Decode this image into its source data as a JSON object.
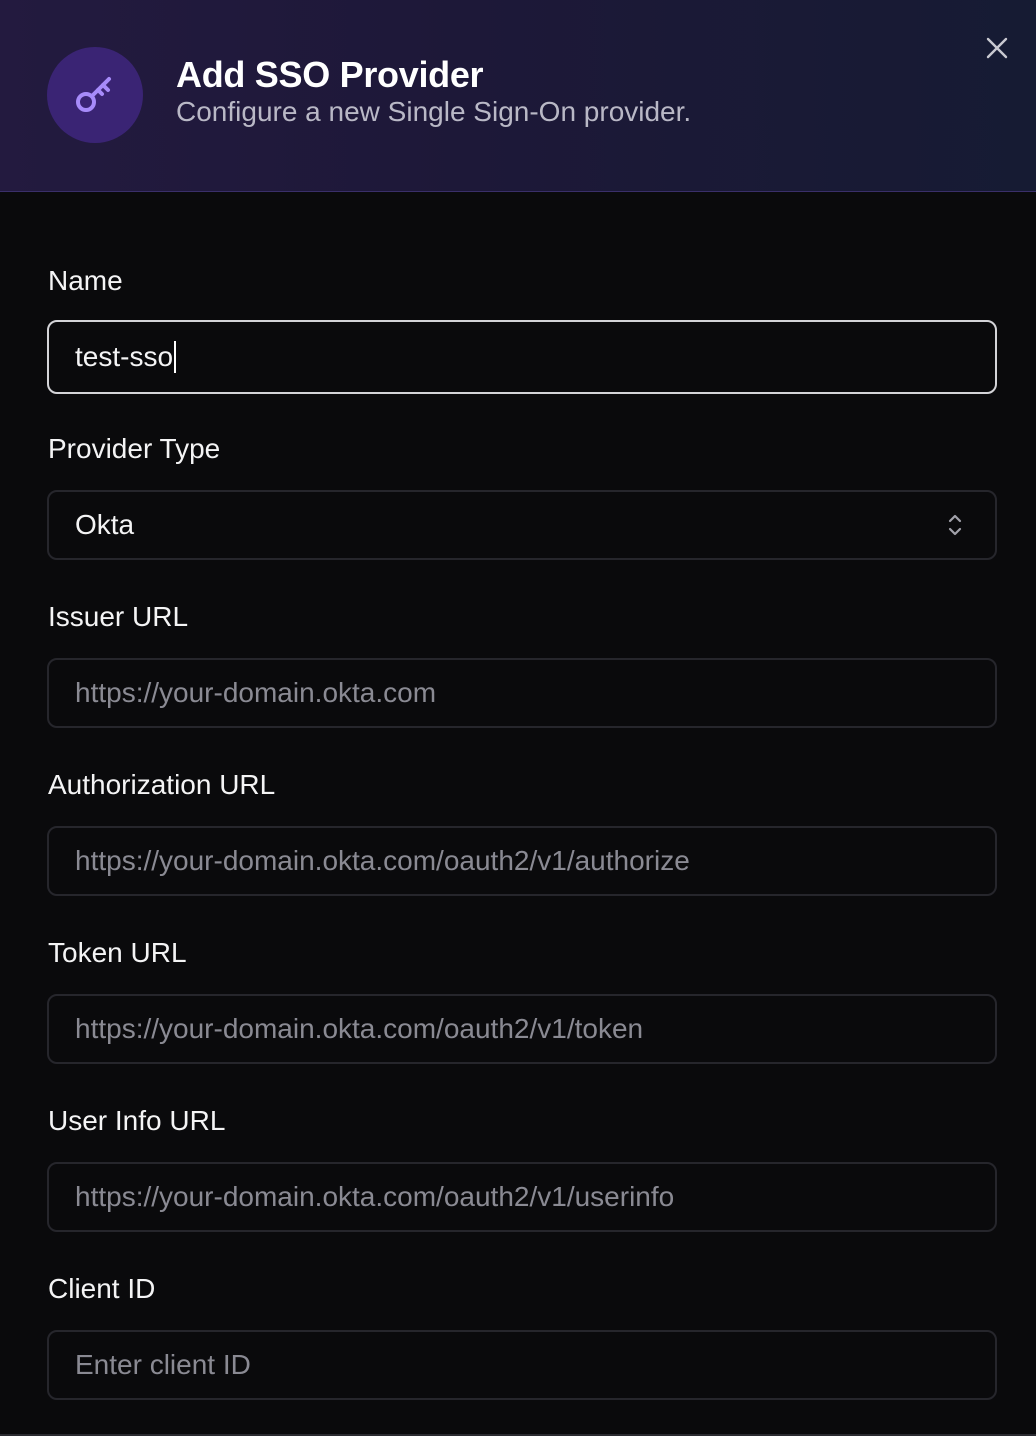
{
  "dialog": {
    "title": "Add SSO Provider",
    "subtitle": "Configure a new Single Sign-On provider.",
    "icon": "key-icon",
    "close_icon": "close-icon",
    "accent_color": "#8b6cf6"
  },
  "fields": {
    "name": {
      "label": "Name",
      "value": "test-sso"
    },
    "provider_type": {
      "label": "Provider Type",
      "value": "Okta"
    },
    "issuer_url": {
      "label": "Issuer URL",
      "placeholder": "https://your-domain.okta.com"
    },
    "authorization_url": {
      "label": "Authorization URL",
      "placeholder": "https://your-domain.okta.com/oauth2/v1/authorize"
    },
    "token_url": {
      "label": "Token URL",
      "placeholder": "https://your-domain.okta.com/oauth2/v1/token"
    },
    "user_info_url": {
      "label": "User Info URL",
      "placeholder": "https://your-domain.okta.com/oauth2/v1/userinfo"
    },
    "client_id": {
      "label": "Client ID",
      "placeholder": "Enter client ID"
    }
  }
}
